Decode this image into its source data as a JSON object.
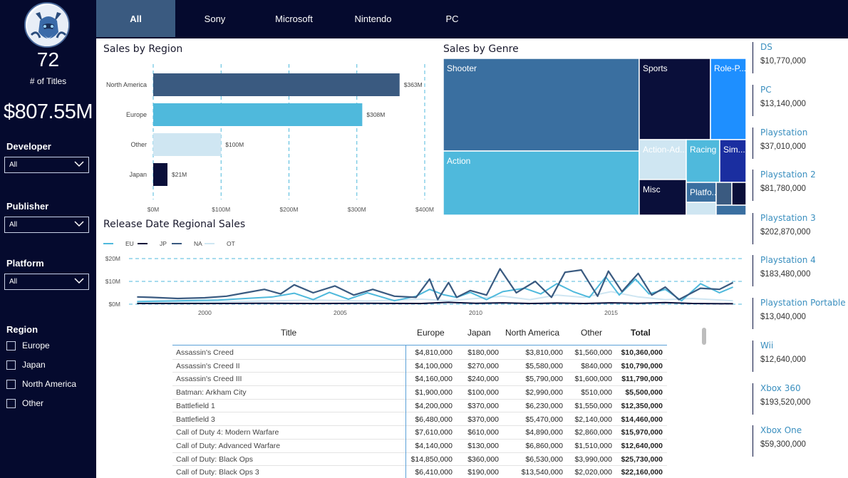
{
  "tabs": [
    "All",
    "Sony",
    "Microsoft",
    "Nintendo",
    "PC"
  ],
  "kpi": {
    "count": "72",
    "count_label": "# of Titles",
    "total": "$807.55M"
  },
  "slicers": {
    "developer": {
      "label": "Developer",
      "value": "All"
    },
    "publisher": {
      "label": "Publisher",
      "value": "All"
    },
    "platform": {
      "label": "Platform",
      "value": "All"
    },
    "region": {
      "label": "Region",
      "options": [
        "Europe",
        "Japan",
        "North America",
        "Other"
      ]
    }
  },
  "region_chart": {
    "title": "Sales by Region",
    "chart_data": {
      "type": "bar",
      "categories": [
        "North America",
        "Europe",
        "Other",
        "Japan"
      ],
      "values": [
        363,
        308,
        100,
        21
      ],
      "data_labels": [
        "$363M",
        "$308M",
        "$100M",
        "$21M"
      ],
      "xlim": [
        0,
        400
      ],
      "xticks": [
        "$0M",
        "$100M",
        "$200M",
        "$300M",
        "$400M"
      ],
      "colors": [
        "#3a5a80",
        "#4fb9dc",
        "#cfe6f2",
        "#0a0f3a"
      ]
    }
  },
  "genre_chart": {
    "title": "Sales by Genre",
    "chart_data": {
      "type": "treemap",
      "labels": [
        "Shooter",
        "Action",
        "Sports",
        "Role-P...",
        "Action-Ad...",
        "Racing",
        "Sim...",
        "Misc",
        "Platfo..."
      ]
    }
  },
  "timeline_chart": {
    "title": "Release Date Regional Sales",
    "chart_data": {
      "type": "line",
      "legend": [
        "EU",
        "JP",
        "NA",
        "OT"
      ],
      "yticks": [
        "$20M",
        "$10M",
        "$0M"
      ],
      "xticks": [
        "2000",
        "2005",
        "2010",
        "2015"
      ],
      "ylim": [
        0,
        20
      ],
      "series": [
        {
          "name": "EU",
          "color": "#4fb9dc",
          "points": [
            [
              1997.5,
              1.2
            ],
            [
              1999,
              1.5
            ],
            [
              2000.5,
              1.8
            ],
            [
              2001.5,
              2.5
            ],
            [
              2002.5,
              3.2
            ],
            [
              2003.3,
              4.8
            ],
            [
              2004,
              2.0
            ],
            [
              2004.6,
              5.2
            ],
            [
              2005.3,
              2.2
            ],
            [
              2006,
              5.0
            ],
            [
              2007,
              1.5
            ],
            [
              2007.8,
              3.5
            ],
            [
              2008.3,
              6.5
            ],
            [
              2008.8,
              4.2
            ],
            [
              2009.3,
              3.0
            ],
            [
              2009.8,
              5.2
            ],
            [
              2010.4,
              2.0
            ],
            [
              2011,
              5.5
            ],
            [
              2011.8,
              7.0
            ],
            [
              2012.4,
              4.5
            ],
            [
              2013,
              9.0
            ],
            [
              2013.6,
              5.5
            ],
            [
              2014.2,
              3.0
            ],
            [
              2014.8,
              12.0
            ],
            [
              2015.3,
              4.0
            ],
            [
              2015.9,
              11.0
            ],
            [
              2016.4,
              4.5
            ],
            [
              2017,
              6.5
            ],
            [
              2017.6,
              1.5
            ],
            [
              2018.3,
              9.0
            ],
            [
              2019,
              5.0
            ],
            [
              2019.5,
              7.5
            ]
          ]
        },
        {
          "name": "JP",
          "color": "#0a0f3a",
          "points": [
            [
              1997.5,
              0.3
            ],
            [
              2000,
              0.3
            ],
            [
              2002,
              0.4
            ],
            [
              2004,
              0.3
            ],
            [
              2006,
              0.4
            ],
            [
              2008,
              0.3
            ],
            [
              2009,
              0.8
            ],
            [
              2010,
              0.4
            ],
            [
              2011,
              0.6
            ],
            [
              2012,
              0.3
            ],
            [
              2013,
              0.5
            ],
            [
              2014,
              0.3
            ],
            [
              2015,
              0.6
            ],
            [
              2016,
              0.4
            ],
            [
              2017,
              0.7
            ],
            [
              2018,
              0.3
            ],
            [
              2019.5,
              0.2
            ]
          ]
        },
        {
          "name": "NA",
          "color": "#3a5a80",
          "points": [
            [
              1997.5,
              3.2
            ],
            [
              1998,
              3.0
            ],
            [
              1999,
              2.5
            ],
            [
              2000,
              2.8
            ],
            [
              2000.8,
              3.5
            ],
            [
              2001.5,
              5.0
            ],
            [
              2002.2,
              6.5
            ],
            [
              2002.8,
              4.5
            ],
            [
              2003.3,
              8.5
            ],
            [
              2004,
              5.0
            ],
            [
              2004.8,
              8.0
            ],
            [
              2005.5,
              4.0
            ],
            [
              2006.2,
              6.5
            ],
            [
              2007,
              3.5
            ],
            [
              2007.8,
              3.0
            ],
            [
              2008.3,
              11.0
            ],
            [
              2008.6,
              2.0
            ],
            [
              2009,
              9.5
            ],
            [
              2009.3,
              3.0
            ],
            [
              2009.8,
              6.0
            ],
            [
              2010.4,
              4.0
            ],
            [
              2010.9,
              15.5
            ],
            [
              2011.5,
              5.0
            ],
            [
              2012.2,
              10.0
            ],
            [
              2012.8,
              3.0
            ],
            [
              2013.3,
              14.0
            ],
            [
              2013.9,
              15.0
            ],
            [
              2014.5,
              3.5
            ],
            [
              2014.9,
              14.5
            ],
            [
              2015.4,
              5.5
            ],
            [
              2016,
              13.5
            ],
            [
              2016.5,
              4.0
            ],
            [
              2017,
              7.5
            ],
            [
              2017.5,
              2.0
            ],
            [
              2018.3,
              7.0
            ],
            [
              2019,
              6.5
            ],
            [
              2019.5,
              9.5
            ]
          ]
        },
        {
          "name": "OT",
          "color": "#cfe6f2",
          "points": [
            [
              1997.5,
              0.8
            ],
            [
              2000,
              1.0
            ],
            [
              2002,
              1.3
            ],
            [
              2004,
              1.8
            ],
            [
              2006,
              1.4
            ],
            [
              2008,
              2.2
            ],
            [
              2009,
              1.5
            ],
            [
              2010,
              2.5
            ],
            [
              2011,
              3.5
            ],
            [
              2012,
              2.0
            ],
            [
              2013,
              4.0
            ],
            [
              2014,
              3.0
            ],
            [
              2015,
              5.5
            ],
            [
              2016,
              3.2
            ],
            [
              2017,
              2.0
            ],
            [
              2018,
              2.5
            ],
            [
              2019.5,
              1.5
            ]
          ]
        }
      ]
    }
  },
  "platforms": [
    {
      "name": "DS",
      "value": "$10,770,000"
    },
    {
      "name": "PC",
      "value": "$13,140,000"
    },
    {
      "name": "Playstation",
      "value": "$37,010,000"
    },
    {
      "name": "Playstation 2",
      "value": "$81,780,000"
    },
    {
      "name": "Playstation 3",
      "value": "$202,870,000"
    },
    {
      "name": "Playstation 4",
      "value": "$183,480,000"
    },
    {
      "name": "Playstation Portable",
      "value": "$13,040,000"
    },
    {
      "name": "Wii",
      "value": "$12,640,000"
    },
    {
      "name": "Xbox 360",
      "value": "$193,520,000"
    },
    {
      "name": "Xbox One",
      "value": "$59,300,000"
    }
  ],
  "table": {
    "headers": [
      "Title",
      "Europe",
      "Japan",
      "North America",
      "Other",
      "Total"
    ],
    "rows": [
      [
        "Assassin's Creed",
        "$4,810,000",
        "$180,000",
        "$3,810,000",
        "$1,560,000",
        "$10,360,000"
      ],
      [
        "Assassin's Creed II",
        "$4,100,000",
        "$270,000",
        "$5,580,000",
        "$840,000",
        "$10,790,000"
      ],
      [
        "Assassin's Creed III",
        "$4,160,000",
        "$240,000",
        "$5,790,000",
        "$1,600,000",
        "$11,790,000"
      ],
      [
        "Batman: Arkham City",
        "$1,900,000",
        "$100,000",
        "$2,990,000",
        "$510,000",
        "$5,500,000"
      ],
      [
        "Battlefield 1",
        "$4,200,000",
        "$370,000",
        "$6,230,000",
        "$1,550,000",
        "$12,350,000"
      ],
      [
        "Battlefield 3",
        "$6,480,000",
        "$370,000",
        "$5,470,000",
        "$2,140,000",
        "$14,460,000"
      ],
      [
        "Call of Duty 4: Modern Warfare",
        "$7,610,000",
        "$610,000",
        "$4,890,000",
        "$2,860,000",
        "$15,970,000"
      ],
      [
        "Call of Duty: Advanced Warfare",
        "$4,140,000",
        "$130,000",
        "$6,860,000",
        "$1,510,000",
        "$12,640,000"
      ],
      [
        "Call of Duty: Black Ops",
        "$14,850,000",
        "$360,000",
        "$6,530,000",
        "$3,990,000",
        "$25,730,000"
      ],
      [
        "Call of Duty: Black Ops 3",
        "$6,410,000",
        "$190,000",
        "$13,540,000",
        "$2,020,000",
        "$22,160,000"
      ]
    ]
  }
}
